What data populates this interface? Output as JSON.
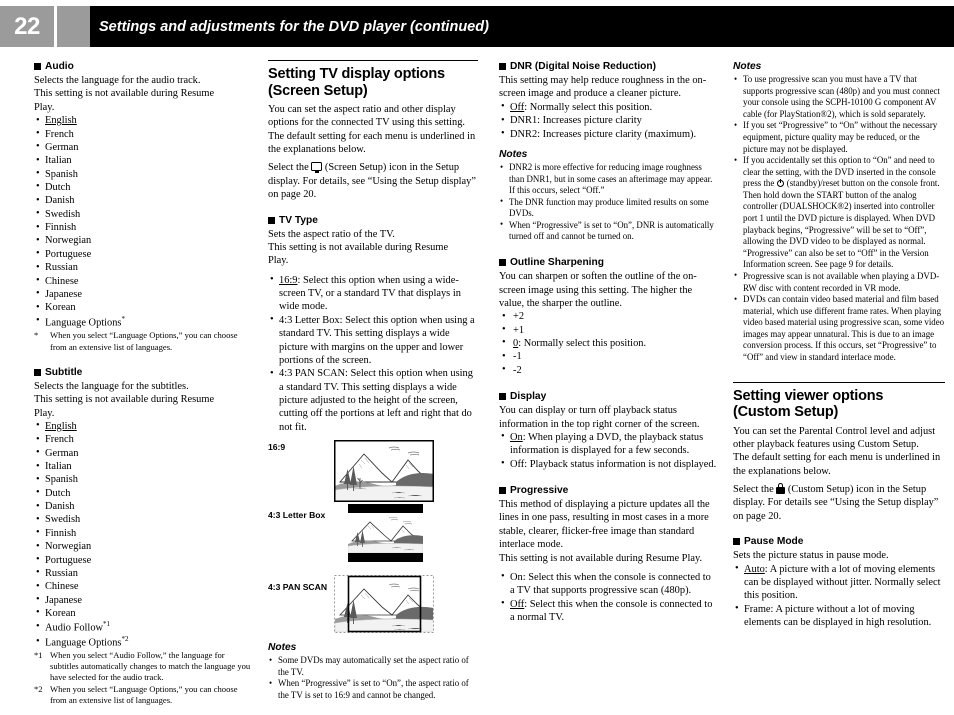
{
  "header": {
    "page_number": "22",
    "title": "Settings and adjustments for the DVD player (continued)"
  },
  "col1": {
    "audio": {
      "heading": "Audio",
      "desc_line1": "Selects the language for the audio track.",
      "desc_line2": "This setting is not available during Resume",
      "desc_line3": "Play.",
      "options": [
        "English",
        "French",
        "German",
        "Italian",
        "Spanish",
        "Dutch",
        "Danish",
        "Swedish",
        "Finnish",
        "Norwegian",
        "Portuguese",
        "Russian",
        "Chinese",
        "Japanese",
        "Korean",
        "Language Options"
      ],
      "underlined_option": "English",
      "footnote_marker": "*",
      "footnote": "When you select “Language Options,” you can choose from an extensive list of languages."
    },
    "subtitle": {
      "heading": "Subtitle",
      "desc_line1": "Selects the language for the subtitles.",
      "desc_line2": "This setting is not available during Resume",
      "desc_line3": "Play.",
      "options": [
        "English",
        "French",
        "German",
        "Italian",
        "Spanish",
        "Dutch",
        "Danish",
        "Swedish",
        "Finnish",
        "Norwegian",
        "Portuguese",
        "Russian",
        "Chinese",
        "Japanese",
        "Korean",
        "Audio Follow",
        "Language Options"
      ],
      "underlined_option": "English",
      "footnote1_marker": "*1",
      "footnote1": "When you select “Audio Follow,” the language for subtitles automatically changes to match the language you have selected for the audio track.",
      "footnote2_marker": "*2",
      "footnote2": "When you select “Language Options,” you can choose from an extensive list of languages."
    }
  },
  "col2": {
    "section_heading_line1": "Setting TV display options",
    "section_heading_line2": "(Screen Setup)",
    "intro": "You can set the aspect ratio and other display options for the connected TV using this setting. The default setting for each menu is underlined in the explanations below.",
    "select_pre": "Select the",
    "select_icon": "screen-setup-icon",
    "select_post": "(Screen Setup) icon in the Setup display. For details, see “Using the Setup display” on page 20.",
    "tv_type": {
      "heading": "TV Type",
      "desc_line1": "Sets the aspect ratio of the TV.",
      "desc_line2": "This setting is not available during Resume",
      "desc_line3": "Play.",
      "options": [
        {
          "label": "16:9",
          "underlined": true,
          "text": ": Select this option when using a wide-screen TV, or a standard TV that displays in wide mode."
        },
        {
          "label": "4:3 Letter Box",
          "underlined": false,
          "text": ": Select this option when using a standard TV. This setting displays a wide picture with margins on the upper and lower portions of the screen."
        },
        {
          "label": "4:3 PAN SCAN",
          "underlined": false,
          "text": ": Select this option when using a standard TV. This setting displays a wide picture adjusted to the height of the screen, cutting off the portions at left and right that do not fit."
        }
      ]
    },
    "figures": [
      {
        "label": "16:9",
        "name": "figure-16-9"
      },
      {
        "label": "4:3 Letter Box",
        "name": "figure-4-3-letter-box"
      },
      {
        "label": "4:3 PAN SCAN",
        "name": "figure-4-3-pan-scan"
      }
    ],
    "notes_heading": "Notes",
    "notes": [
      "Some DVDs may automatically set the aspect ratio of the TV.",
      "When “Progressive” is set to “On”, the aspect ratio of the TV is set to 16:9 and cannot be changed."
    ]
  },
  "col3": {
    "dnr": {
      "heading": "DNR (Digital Noise Reduction)",
      "desc": "This setting may help reduce roughness in the on-screen image and produce a cleaner picture.",
      "options": [
        {
          "label": "Off",
          "underlined": true,
          "text": ": Normally select this position."
        },
        {
          "label": "DNR1",
          "underlined": false,
          "text": ": Increases picture clarity"
        },
        {
          "label": "DNR2",
          "underlined": false,
          "text": ": Increases picture clarity (maximum)."
        }
      ],
      "notes_heading": "Notes",
      "notes": [
        "DNR2 is more effective for reducing image roughness than DNR1, but in some cases an afterimage may appear. If this occurs, select “Off.”",
        "The DNR function may produce limited results on some DVDs.",
        "When “Progressive” is set to “On”, DNR is automatically turned off and cannot be turned on."
      ]
    },
    "outline": {
      "heading": "Outline Sharpening",
      "desc": "You can sharpen or soften the outline of the on-screen image using this setting. The higher the value, the sharper the outline.",
      "options": [
        {
          "label": "+2",
          "underlined": false,
          "text": ""
        },
        {
          "label": "+1",
          "underlined": false,
          "text": ""
        },
        {
          "label": "0",
          "underlined": true,
          "text": ": Normally select this position."
        },
        {
          "label": "-1",
          "underlined": false,
          "text": ""
        },
        {
          "label": "-2",
          "underlined": false,
          "text": ""
        }
      ]
    },
    "display": {
      "heading": "Display",
      "desc": "You can display or turn off playback status information in the top right corner of the screen.",
      "options": [
        {
          "label": "On",
          "underlined": true,
          "text": ": When playing a DVD, the playback status information is displayed for a few seconds."
        },
        {
          "label": "Off",
          "underlined": false,
          "text": ": Playback status information is not displayed."
        }
      ]
    },
    "progressive": {
      "heading": "Progressive",
      "desc_line1": "This method of displaying a picture updates all the lines in one pass, resulting in most cases in a more stable, clearer, flicker-free image than standard interlace mode.",
      "desc_line2": "This setting is not available during Resume Play.",
      "options": [
        {
          "label": "On",
          "underlined": false,
          "text": ": Select this when the console is connected to a TV that supports progressive scan (480p)."
        },
        {
          "label": "Off",
          "underlined": true,
          "text": ": Select this when the console is connected to a normal TV."
        }
      ]
    }
  },
  "col4": {
    "notes_heading": "Notes",
    "notes": [
      "To use progressive scan you must have a TV that supports progressive scan (480p) and you must connect your console using the SCPH-10100 G component AV cable (for PlayStation®2), which is sold separately.",
      "If you set “Progressive” to “On” without the necessary equipment, picture quality may be reduced, or the picture may not be displayed.",
      "If you accidentally set this option to “On” and need to clear the setting, with the DVD inserted in the console press the ⏻ (standby)/reset button on the console front. Then hold down the START button of the analog controller (DUALSHOCK®2) inserted into controller port 1 until the DVD picture is displayed. When DVD playback begins, “Progressive” will be set to “Off”, allowing the DVD video to be displayed as normal. “Progressive” can also be set to “Off” in the Version Information screen. See page 9 for details.",
      "Progressive scan is not available when playing a DVD-RW disc with content recorded in VR mode.",
      "DVDs can contain video based material and film based material, which use different frame rates. When playing video based material using progressive scan, some video images may appear unnatural. This is due to an image conversion process. If this occurs, set “Progressive” to “Off” and view in standard interlace mode."
    ],
    "note3_part1": "If you accidentally set this option to “On” and need to clear the setting, with the DVD inserted in the console press the",
    "note3_icon": "standby-power-icon",
    "note3_part2": "(standby)/reset button on the console front. Then  hold down the START button of the analog controller (DUALSHOCK®2) inserted into controller port 1 until the DVD picture is displayed. When DVD playback begins, “Progressive” will be set to “Off”, allowing the DVD video to be displayed as normal. “Progressive” can also be set to “Off” in the Version Information screen. See page 9 for details.",
    "section_heading_line1": "Setting viewer options",
    "section_heading_line2": "(Custom Setup)",
    "intro_line1": "You can set the Parental Control level and adjust other playback features using Custom Setup.",
    "intro_line2": "The default setting for each menu is underlined in the explanations below.",
    "select_pre": "Select the",
    "select_icon": "custom-setup-lock-icon",
    "select_post": "(Custom Setup) icon in the Setup display. For details see “Using the Setup display” on page 20.",
    "pause_mode": {
      "heading": "Pause Mode",
      "desc": "Sets the picture status in pause mode.",
      "options": [
        {
          "label": "Auto",
          "underlined": true,
          "text": ": A picture with a lot of moving elements can be displayed without jitter. Normally select this position."
        },
        {
          "label": "Frame",
          "underlined": false,
          "text": ": A picture without a lot of moving elements can be displayed in high resolution."
        }
      ]
    }
  },
  "colors": {
    "header_gray": "#9b9b9b",
    "header_black": "#000000",
    "text": "#000000",
    "page_bg": "#ffffff"
  }
}
